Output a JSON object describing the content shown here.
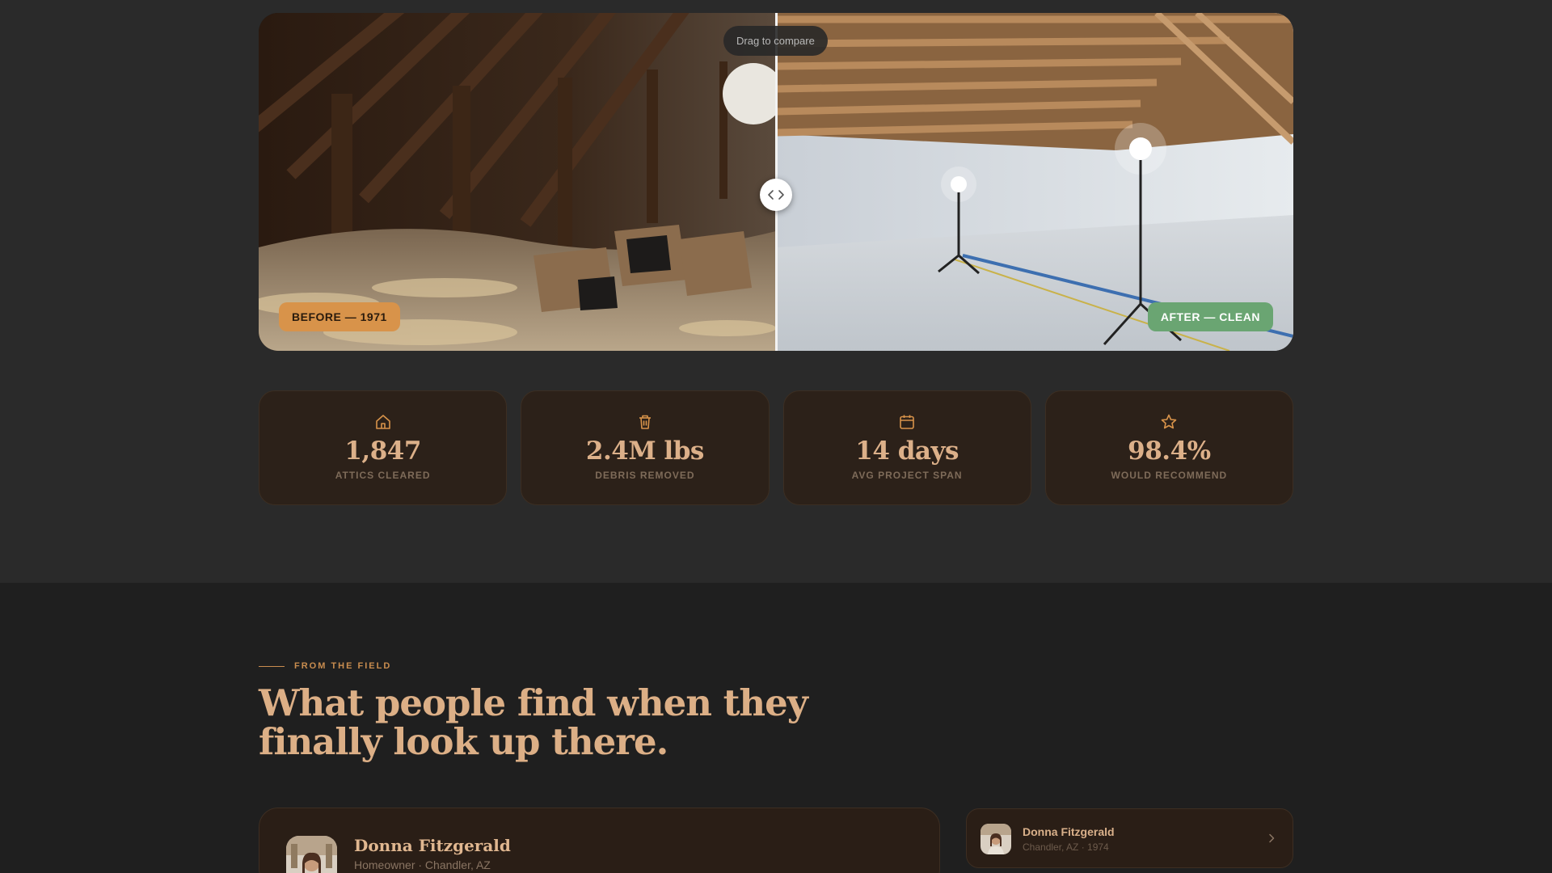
{
  "comparison": {
    "hint": "Drag to compare",
    "before_label": "BEFORE — 1971",
    "after_label": "AFTER — CLEAN",
    "before_image": "cluttered-attic-photo",
    "after_image": "clean-attic-photo",
    "handle_icon": "arrows-left-right-icon"
  },
  "stats": [
    {
      "icon": "house-icon",
      "value": "1,847",
      "label": "ATTICS CLEARED"
    },
    {
      "icon": "trash-icon",
      "value": "2.4M lbs",
      "label": "DEBRIS REMOVED"
    },
    {
      "icon": "calendar-icon",
      "value": "14 days",
      "label": "AVG PROJECT SPAN"
    },
    {
      "icon": "star-icon",
      "value": "98.4%",
      "label": "WOULD RECOMMEND"
    }
  ],
  "section": {
    "eyebrow": "FROM THE FIELD",
    "headline": "What people find when they finally look up there."
  },
  "testimonial": {
    "name": "Donna Fitzgerald",
    "meta": "Homeowner · Chandler, AZ"
  },
  "testimonial_list": [
    {
      "name": "Donna Fitzgerald",
      "meta": "Chandler, AZ · 1974",
      "icon": "chevron-right-icon"
    }
  ],
  "colors": {
    "accent": "#c98d4f",
    "heading": "#dcaf86",
    "before_badge": "#d8934a",
    "after_badge": "#6aa572",
    "card_bg": "#2c2119"
  }
}
